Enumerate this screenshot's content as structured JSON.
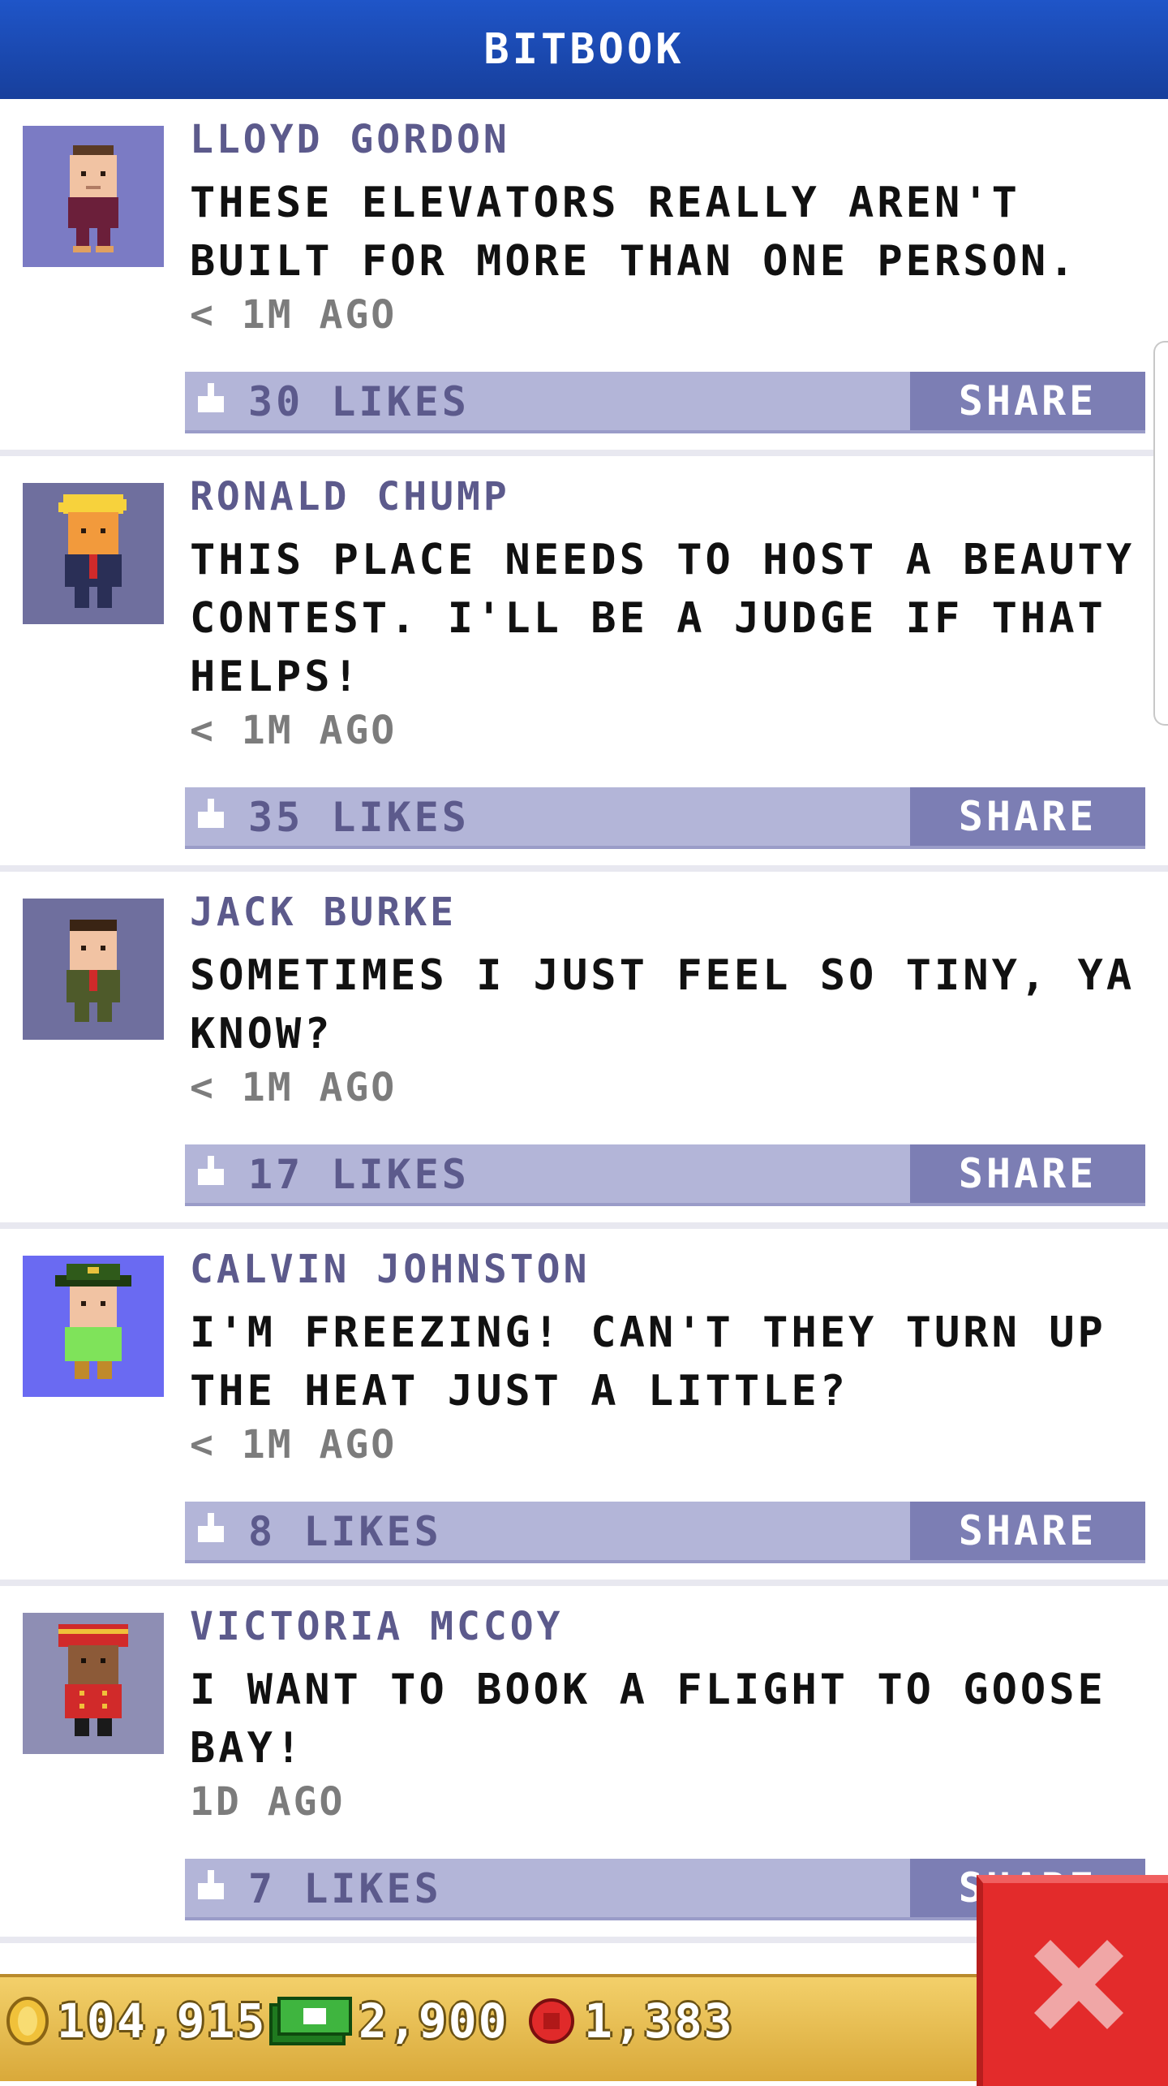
{
  "header": {
    "title": "BITBOOK"
  },
  "posts": [
    {
      "name": "LLOYD GORDON",
      "message": "THESE ELEVATORS REALLY AREN'T BUILT FOR MORE THAN ONE PERSON.",
      "time": "< 1M AGO",
      "likes": "30 LIKES",
      "share": "SHARE"
    },
    {
      "name": "RONALD CHUMP",
      "message": "THIS PLACE NEEDS TO HOST A BEAUTY CONTEST. I'LL BE A JUDGE IF THAT HELPS!",
      "time": "< 1M AGO",
      "likes": "35 LIKES",
      "share": "SHARE"
    },
    {
      "name": "JACK BURKE",
      "message": "SOMETIMES I JUST FEEL SO TINY, YA KNOW?",
      "time": "< 1M AGO",
      "likes": "17 LIKES",
      "share": "SHARE"
    },
    {
      "name": "CALVIN JOHNSTON",
      "message": "I'M FREEZING! CAN'T THEY TURN UP THE HEAT JUST A LITTLE?",
      "time": "< 1M AGO",
      "likes": "8 LIKES",
      "share": "SHARE"
    },
    {
      "name": "VICTORIA MCCOY",
      "message": "I WANT TO BOOK A FLIGHT TO GOOSE BAY!",
      "time": "1D AGO",
      "likes": "7 LIKES",
      "share": "SHARE"
    }
  ],
  "bottom_bar": {
    "coins": "104,915",
    "bux": "2,900",
    "tickets": "1,383"
  },
  "icons": {
    "like": "thumbs-up-icon",
    "close": "close-icon",
    "coins": "coin-icon",
    "bux": "bux-icon",
    "tickets": "ticket-icon"
  },
  "colors": {
    "header": "#1f55c8",
    "name": "#5c5a8c",
    "like_bar": "#b3b5d8",
    "share_button": "#7c7eb4",
    "close_button": "#e32b2b",
    "bottom_bar": "#f3d06a"
  }
}
